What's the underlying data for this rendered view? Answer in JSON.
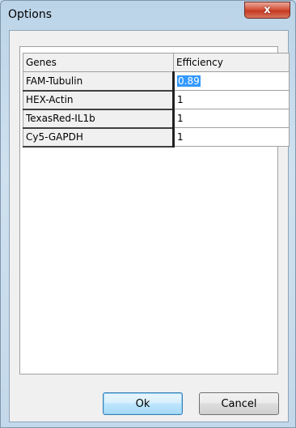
{
  "window": {
    "title": "Options",
    "close_glyph": "x"
  },
  "grid": {
    "columns": [
      "Genes",
      "Efficiency"
    ],
    "rows": [
      {
        "gene": "FAM-Tubulin",
        "efficiency": "0.89",
        "selected": true
      },
      {
        "gene": "HEX-Actin",
        "efficiency": "1"
      },
      {
        "gene": "TexasRed-IL1b",
        "efficiency": "1"
      },
      {
        "gene": "Cy5-GAPDH",
        "efficiency": "1"
      }
    ],
    "selection_color": "#3399ff"
  },
  "buttons": {
    "ok_label": "Ok",
    "cancel_label": "Cancel"
  },
  "icons": {
    "close": "close-icon"
  }
}
